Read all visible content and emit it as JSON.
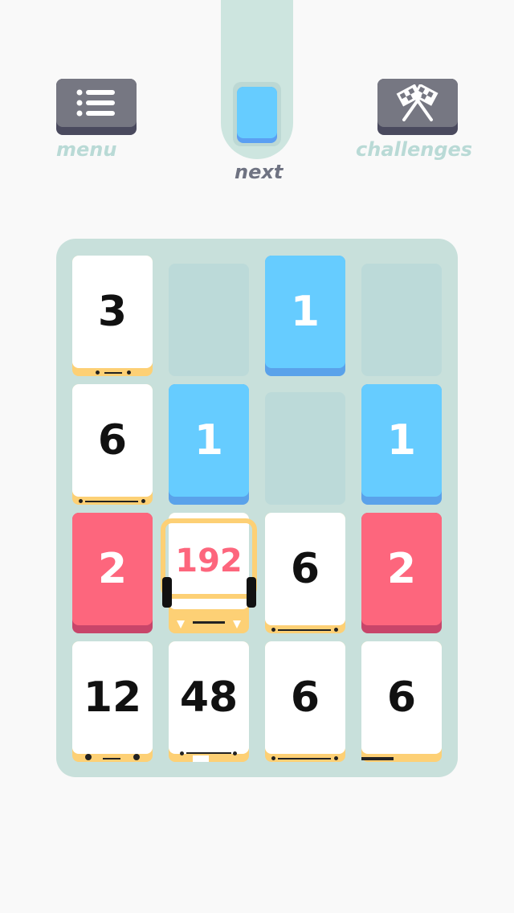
{
  "controls": {
    "menu_label": "menu",
    "challenges_label": "challenges",
    "next_label": "next"
  },
  "next_card": {
    "color": "blue"
  },
  "colors": {
    "background": "#f9f9f9",
    "board": "#c8e0db",
    "empty_slot": "#bcdad9",
    "blue": "#66ccff",
    "red": "#fd667d",
    "white": "#ffffff",
    "gold": "#fdd075",
    "label": "#b9dad6"
  },
  "board": {
    "rows": [
      [
        {
          "value": "3",
          "color": "white"
        },
        {
          "value": "",
          "color": "empty"
        },
        {
          "value": "1",
          "color": "blue"
        },
        {
          "value": "",
          "color": "empty"
        }
      ],
      [
        {
          "value": "6",
          "color": "white"
        },
        {
          "value": "1",
          "color": "blue"
        },
        {
          "value": "",
          "color": "empty"
        },
        {
          "value": "1",
          "color": "blue"
        }
      ],
      [
        {
          "value": "2",
          "color": "red"
        },
        {
          "value": "192",
          "color": "highlight"
        },
        {
          "value": "6",
          "color": "white"
        },
        {
          "value": "2",
          "color": "red"
        }
      ],
      [
        {
          "value": "12",
          "color": "white"
        },
        {
          "value": "48",
          "color": "white"
        },
        {
          "value": "6",
          "color": "white"
        },
        {
          "value": "6",
          "color": "white"
        }
      ]
    ]
  }
}
